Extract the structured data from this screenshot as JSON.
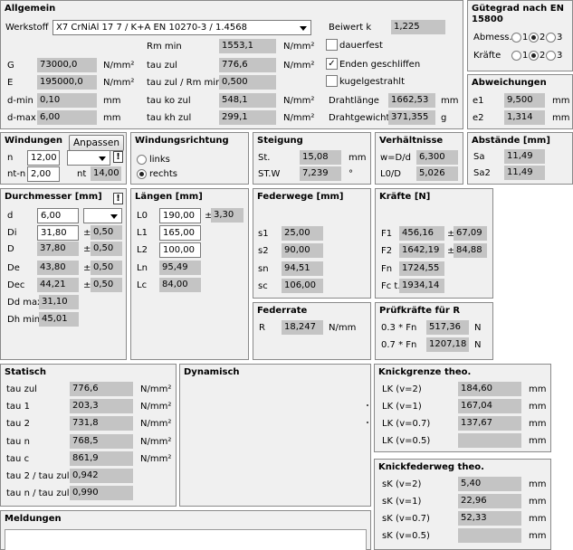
{
  "allgemein": {
    "title": "Allgemein",
    "werkstoff_label": "Werkstoff",
    "werkstoff_value": "X7 CrNiAl 17 7 / K+A EN 10270-3 / 1.4568",
    "beiwert_label": "Beiwert k",
    "beiwert_value": "1,225",
    "rm_min_label": "Rm min",
    "rm_min_value": "1553,1",
    "rm_min_unit": "N/mm²",
    "dauerfest_label": "dauerfest",
    "dauerfest_checked": false,
    "G_label": "G",
    "G_value": "73000,0",
    "G_unit": "N/mm²",
    "tau_zul_label": "tau zul",
    "tau_zul_value": "776,6",
    "tau_zul_unit": "N/mm²",
    "enden_label": "Enden geschliffen",
    "enden_checked": true,
    "E_label": "E",
    "E_value": "195000,0",
    "E_unit": "N/mm²",
    "tau_rm_label": "tau zul / Rm min",
    "tau_rm_value": "0,500",
    "kugel_label": "kugelgestrahlt",
    "kugel_checked": false,
    "dmin_label": "d-min",
    "dmin_value": "0,10",
    "dmin_unit": "mm",
    "tau_ko_label": "tau ko zul",
    "tau_ko_value": "548,1",
    "tau_ko_unit": "N/mm²",
    "drahtlaenge_label": "Drahtlänge",
    "drahtlaenge_value": "1662,53",
    "drahtlaenge_unit": "mm",
    "dmax_label": "d-max",
    "dmax_value": "6,00",
    "dmax_unit": "mm",
    "tau_kh_label": "tau kh zul",
    "tau_kh_value": "299,1",
    "tau_kh_unit": "N/mm²",
    "drahtgewicht_label": "Drahtgewicht",
    "drahtgewicht_value": "371,355",
    "drahtgewicht_unit": "g"
  },
  "guetegrad": {
    "title_line1": "Gütegrad nach EN",
    "title_line2": "15800",
    "abmess_label": "Abmess.",
    "kraefte_label": "Kräfte",
    "opt1": "1",
    "opt2": "2",
    "opt3": "3",
    "abmess_selected": 2,
    "kraefte_selected": 2
  },
  "abweichungen": {
    "title": "Abweichungen",
    "e1_label": "e1",
    "e1_value": "9,500",
    "e1_unit": "mm",
    "e2_label": "e2",
    "e2_value": "1,314",
    "e2_unit": "mm"
  },
  "windungen": {
    "title": "Windungen",
    "anpassen_label": "Anpassen",
    "n_label": "n",
    "n_value": "12,00",
    "ntn_label": "nt-n",
    "ntn_value": "2,00",
    "nt_label": "nt",
    "nt_value": "14,00",
    "warn": "!"
  },
  "windungsrichtung": {
    "title": "Windungsrichtung",
    "links_label": "links",
    "rechts_label": "rechts",
    "selected": "rechts"
  },
  "steigung": {
    "title": "Steigung",
    "st_label": "St.",
    "st_value": "15,08",
    "st_unit": "mm",
    "stw_label": "ST.W",
    "stw_value": "7,239",
    "stw_unit": "°"
  },
  "verhaeltnisse": {
    "title": "Verhältnisse",
    "wdd_label": "w=D/d",
    "wdd_value": "6,300",
    "l0d_label": "L0/D",
    "l0d_value": "5,026"
  },
  "abstaende": {
    "title": "Abstände [mm]",
    "sa_label": "Sa",
    "sa_value": "11,49",
    "sa2_label": "Sa2",
    "sa2_value": "11,49"
  },
  "durchmesser": {
    "title": "Durchmesser [mm]",
    "warn": "!",
    "d_label": "d",
    "d_value": "6,00",
    "Di_label": "Di",
    "Di_value": "31,80",
    "Di_tol": "0,50",
    "D_label": "D",
    "D_value": "37,80",
    "D_tol": "0,50",
    "De_label": "De",
    "De_value": "43,80",
    "De_tol": "0,50",
    "Dec_label": "Dec",
    "Dec_value": "44,21",
    "Dec_tol": "0,50",
    "Ddmax_label": "Dd max",
    "Ddmax_value": "31,10",
    "Dhmin_label": "Dh min",
    "Dhmin_value": "45,01",
    "pm": "±"
  },
  "laengen": {
    "title": "Längen [mm]",
    "L0_label": "L0",
    "L0_value": "190,00",
    "L0_tol": "3,30",
    "L1_label": "L1",
    "L1_value": "165,00",
    "L2_label": "L2",
    "L2_value": "100,00",
    "Ln_label": "Ln",
    "Ln_value": "95,49",
    "Lc_label": "Lc",
    "Lc_value": "84,00",
    "pm": "±"
  },
  "federwege": {
    "title": "Federwege [mm]",
    "s1_label": "s1",
    "s1_value": "25,00",
    "s2_label": "s2",
    "s2_value": "90,00",
    "sn_label": "sn",
    "sn_value": "94,51",
    "sc_label": "sc",
    "sc_value": "106,00"
  },
  "kraefte": {
    "title": "Kräfte [N]",
    "F1_label": "F1",
    "F1_value": "456,16",
    "F1_tol": "67,09",
    "F2_label": "F2",
    "F2_value": "1642,19",
    "F2_tol": "84,88",
    "Fn_label": "Fn",
    "Fn_value": "1724,55",
    "Fct_label": "Fc t.",
    "Fct_value": "1934,14",
    "pm": "±"
  },
  "federrate": {
    "title": "Federrate",
    "R_label": "R",
    "R_value": "18,247",
    "R_unit": "N/mm"
  },
  "pruefkraefte": {
    "title": "Prüfkräfte für R",
    "p1_label": "0.3 * Fn",
    "p1_value": "517,36",
    "p1_unit": "N",
    "p2_label": "0.7 * Fn",
    "p2_value": "1207,18",
    "p2_unit": "N"
  },
  "statisch": {
    "title": "Statisch",
    "rows": [
      {
        "label": "tau zul",
        "value": "776,6",
        "unit": "N/mm²"
      },
      {
        "label": "tau 1",
        "value": "203,3",
        "unit": "N/mm²"
      },
      {
        "label": "tau 2",
        "value": "731,8",
        "unit": "N/mm²"
      },
      {
        "label": "tau n",
        "value": "768,5",
        "unit": "N/mm²"
      },
      {
        "label": "tau c",
        "value": "861,9",
        "unit": "N/mm²"
      },
      {
        "label": "tau 2 / tau zul",
        "value": "0,942",
        "unit": ""
      },
      {
        "label": "tau n / tau zul",
        "value": "0,990",
        "unit": ""
      }
    ]
  },
  "dynamisch": {
    "title": "Dynamisch"
  },
  "knickgrenze": {
    "title": "Knickgrenze theo.",
    "rows": [
      {
        "label": "LK (v=2)",
        "value": "184,60",
        "unit": "mm"
      },
      {
        "label": "LK (v=1)",
        "value": "167,04",
        "unit": "mm"
      },
      {
        "label": "LK (v=0.7)",
        "value": "137,67",
        "unit": "mm"
      },
      {
        "label": "LK (v=0.5)",
        "value": "",
        "unit": "mm"
      }
    ]
  },
  "knickfederweg": {
    "title": "Knickfederweg theo.",
    "rows": [
      {
        "label": "sK (v=2)",
        "value": "5,40",
        "unit": "mm"
      },
      {
        "label": "sK (v=1)",
        "value": "22,96",
        "unit": "mm"
      },
      {
        "label": "sK (v=0.7)",
        "value": "52,33",
        "unit": "mm"
      },
      {
        "label": "sK (v=0.5)",
        "value": "",
        "unit": "mm"
      }
    ]
  },
  "meldungen": {
    "title": "Meldungen"
  }
}
